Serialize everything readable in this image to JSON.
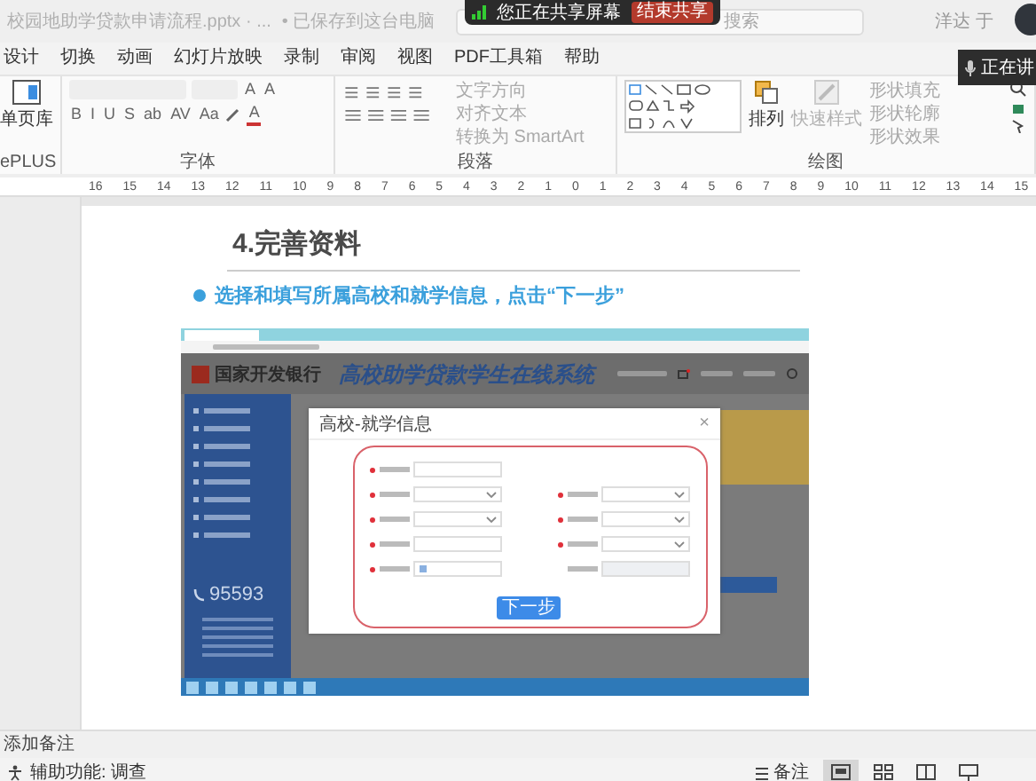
{
  "title_bar": {
    "file_name": "校园地助学贷款申请流程.pptx · ...",
    "save_status": "• 已保存到这台电脑",
    "search": {
      "placeholder": "搜索"
    },
    "user": "洋达 于"
  },
  "share_banner": {
    "text": "您正在共享屏幕",
    "button": "结束共享"
  },
  "presenter_badge": {
    "text": "正在讲"
  },
  "tabs": [
    {
      "label": "设计",
      "selected": false
    },
    {
      "label": "切换",
      "selected": false
    },
    {
      "label": "动画",
      "selected": false
    },
    {
      "label": "幻灯片放映",
      "selected": false
    },
    {
      "label": "录制",
      "selected": false
    },
    {
      "label": "审阅",
      "selected": false
    },
    {
      "label": "视图",
      "selected": false
    },
    {
      "label": "PDF工具箱",
      "selected": false
    },
    {
      "label": "帮助",
      "selected": false
    }
  ],
  "ribbon": {
    "addin_group": {
      "button": "单页库",
      "label": "ePLUS"
    },
    "font_group": {
      "label": "字体",
      "size_buttons": [
        "A",
        "A"
      ],
      "buttons": [
        "B",
        "I",
        "U",
        "S",
        "ab",
        "AV",
        "Aa"
      ],
      "color_button": "A"
    },
    "paragraph_group": {
      "label": "段落",
      "commands": [
        {
          "label": "文字方向",
          "disabled": true
        },
        {
          "label": "对齐文本",
          "disabled": true
        },
        {
          "label": "转换为 SmartArt",
          "disabled": true
        }
      ]
    },
    "drawing_group": {
      "label": "绘图",
      "arrange": {
        "label": "排列",
        "disabled": false
      },
      "quick_styles": {
        "label": "快速样式",
        "disabled": true
      },
      "commands": [
        {
          "label": "形状填充",
          "disabled": true
        },
        {
          "label": "形状轮廓",
          "disabled": true
        },
        {
          "label": "形状效果",
          "disabled": true
        }
      ]
    }
  },
  "ruler": [
    "16",
    "15",
    "14",
    "13",
    "12",
    "11",
    "10",
    "9",
    "8",
    "7",
    "6",
    "5",
    "4",
    "3",
    "2",
    "1",
    "0",
    "1",
    "2",
    "3",
    "4",
    "5",
    "6",
    "7",
    "8",
    "9",
    "10",
    "11",
    "12",
    "13",
    "14",
    "15"
  ],
  "slide": {
    "title": "4.完善资料",
    "bullet": "选择和填写所属高校和就学信息，点击“下一步”",
    "screenshot": {
      "bank_name": "国家开发银行",
      "system_title": "高校助学贷款学生在线系统",
      "hotline": "95593",
      "dialog": {
        "title": "高校-就学信息",
        "close": "×",
        "left_fields": [
          {
            "kind": "text",
            "required": true
          },
          {
            "kind": "select",
            "required": true
          },
          {
            "kind": "select",
            "required": true
          },
          {
            "kind": "text",
            "required": true
          },
          {
            "kind": "date",
            "required": true
          }
        ],
        "right_fields": [
          {
            "kind": "select",
            "required": true
          },
          {
            "kind": "select",
            "required": true
          },
          {
            "kind": "select",
            "required": true
          },
          {
            "kind": "readonly",
            "required": false
          }
        ],
        "button": "下一步"
      }
    }
  },
  "notes": {
    "hint": "添加备注"
  },
  "status_bar": {
    "accessibility": "辅助功能: 调查",
    "notes_button": "备注",
    "views": [
      {
        "kind": "normal",
        "selected": true
      },
      {
        "kind": "sorter",
        "selected": false
      },
      {
        "kind": "reading",
        "selected": false
      },
      {
        "kind": "show",
        "selected": false
      }
    ]
  }
}
